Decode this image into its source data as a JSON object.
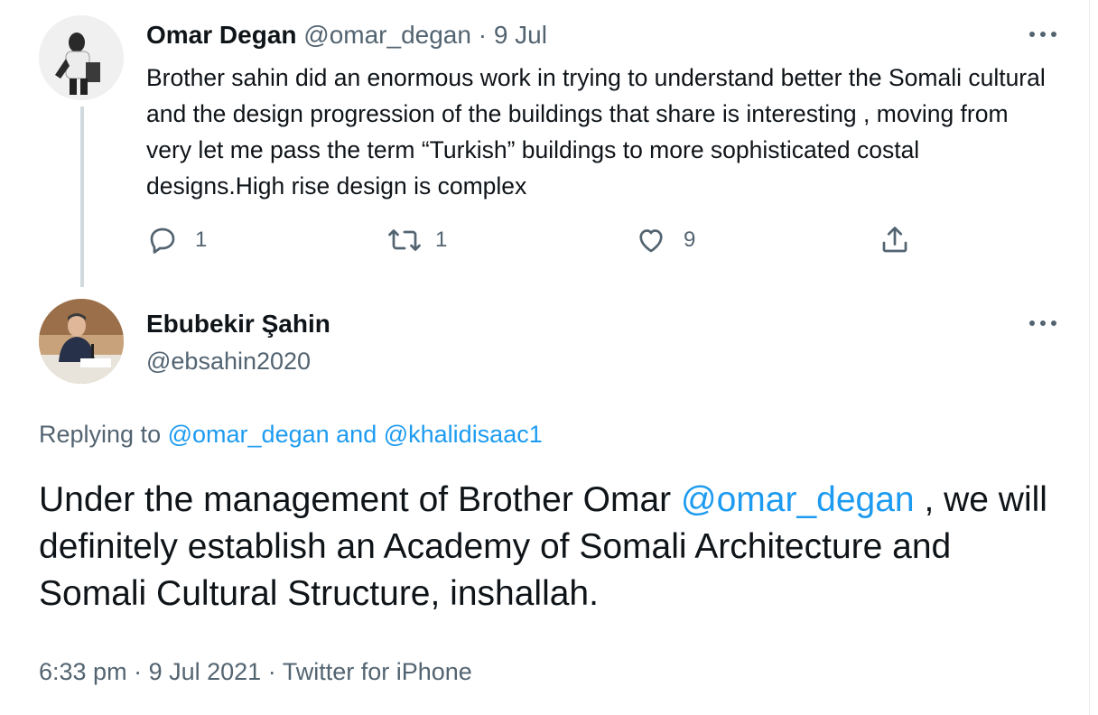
{
  "tweet1": {
    "author_name": "Omar Degan",
    "author_handle": "@omar_degan",
    "separator": "·",
    "date": "9 Jul",
    "text": "Brother sahin did an enormous work in trying to understand better the Somali cultural and the design progression of the buildings that share is interesting , moving from very let me pass the term “Turkish” buildings to more sophisticated costal designs.High rise design is complex",
    "reply_count": "1",
    "retweet_count": "1",
    "like_count": "9"
  },
  "tweet2": {
    "author_name": "Ebubekir Şahin",
    "author_handle": "@ebsahin2020",
    "replying_prefix": "Replying to",
    "replying_to": [
      "@omar_degan",
      "@khalidisaac1"
    ],
    "replying_joiner": "and",
    "text_part1": "Under the management of Brother Omar",
    "mention": "@omar_degan",
    "text_part2": " , we will definitely establish an Academy of Somali Architecture and Somali Cultural Structure, inshallah.",
    "time": "6:33 pm",
    "date": "9 Jul 2021",
    "source": "Twitter for iPhone",
    "separator": "·"
  },
  "icons": {
    "reply": "reply-icon",
    "retweet": "retweet-icon",
    "like": "heart-icon",
    "share": "share-icon",
    "more": "more-icon"
  },
  "colors": {
    "link": "#1d9bf0",
    "muted": "#536471",
    "text": "#0f1419",
    "thread_line": "#cfd9de"
  }
}
